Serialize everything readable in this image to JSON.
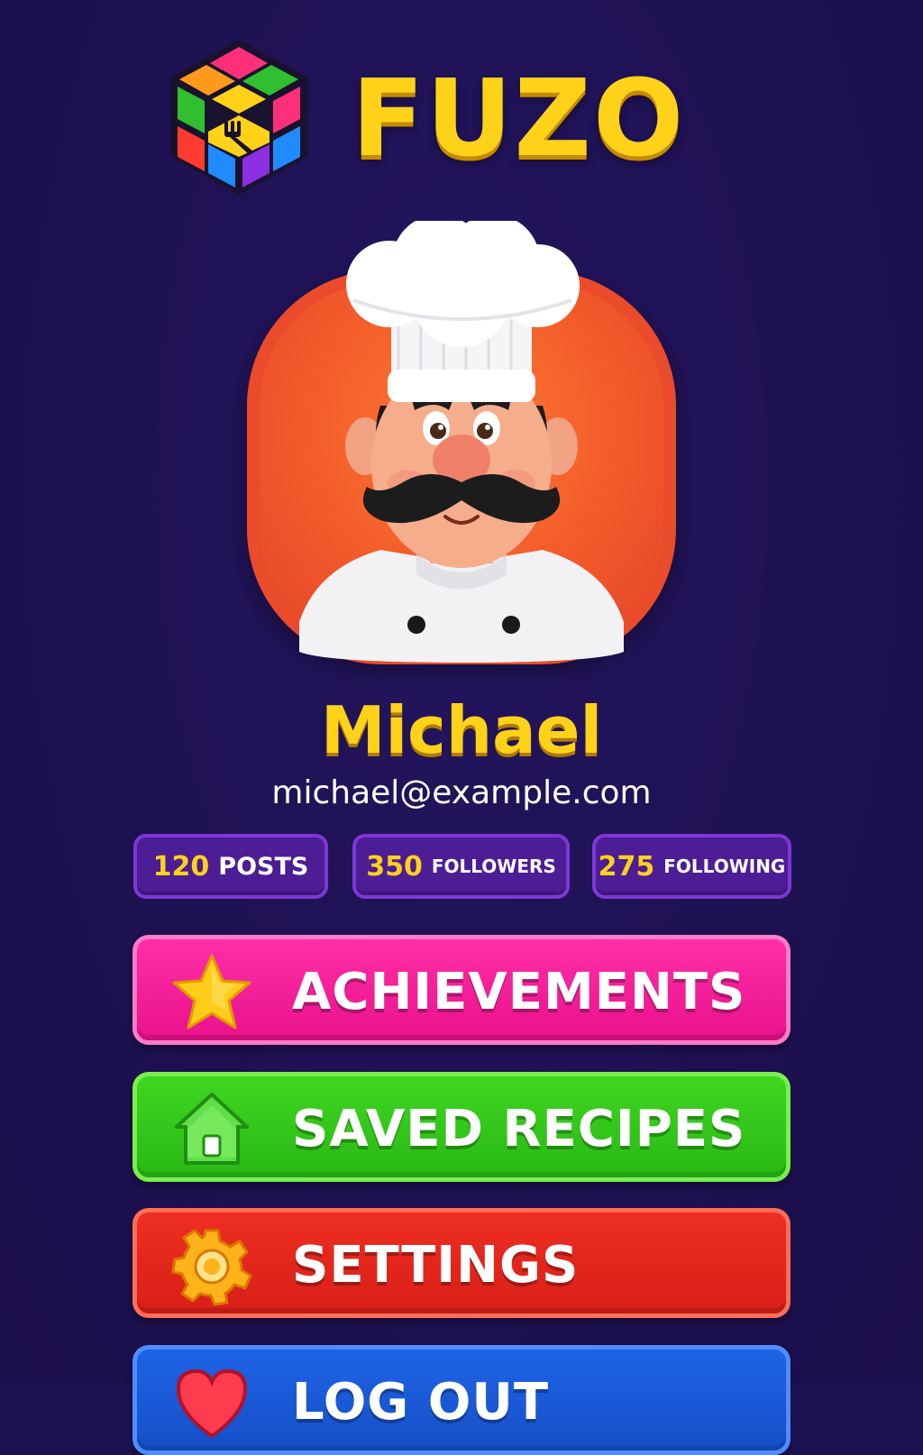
{
  "app": {
    "brand_name": "FUZO"
  },
  "profile": {
    "name": "Michael",
    "email": "michael@example.com",
    "avatar_icon": "chef-avatar"
  },
  "stats": {
    "posts": {
      "value": "120",
      "label": "POSTS"
    },
    "followers": {
      "value": "350",
      "label": "FOLLOWERS"
    },
    "following": {
      "value": "275",
      "label": "FOLLOWING"
    }
  },
  "menu": {
    "achievements": {
      "label": "ACHIEVEMENTS",
      "icon": "star-icon",
      "color": "#f0189a"
    },
    "saved_recipes": {
      "label": "SAVED RECIPES",
      "icon": "house-icon",
      "color": "#33c61b"
    },
    "settings": {
      "label": "SETTINGS",
      "icon": "gear-icon",
      "color": "#e2241b"
    },
    "logout": {
      "label": "LOG OUT",
      "icon": "heart-icon",
      "color": "#1a59d6"
    }
  },
  "colors": {
    "background": "#1f1254",
    "accent_yellow": "#ffd21a",
    "stat_badge": "#4c1d95"
  }
}
